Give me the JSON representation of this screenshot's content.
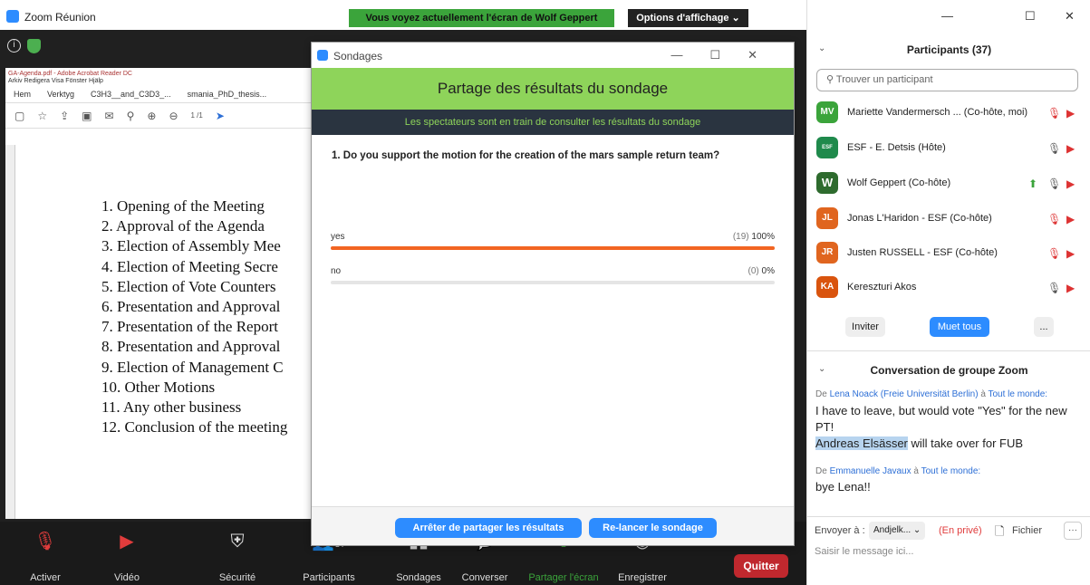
{
  "window": {
    "title": "Zoom Réunion"
  },
  "banner": {
    "text": "Vous voyez actuellement l'écran de Wolf Geppert",
    "options": "Options d'affichage ⌄"
  },
  "acrobat": {
    "title": "GA-Agenda.pdf - Adobe Acrobat Reader DC",
    "menu": "Arkiv  Redigera  Visa  Fönster  Hjälp",
    "tabs": [
      "Hem",
      "Verktyg",
      "C3H3__and_C3D3_...",
      "smania_PhD_thesis..."
    ],
    "page": "1 /1"
  },
  "agenda": [
    "1. Opening of the Meeting",
    "2. Approval of the Agenda",
    "3. Election of Assembly Mee",
    "4. Election of Meeting Secre",
    "5. Election of Vote Counters",
    "6. Presentation and Approval",
    "7. Presentation of the Report",
    "8. Presentation and Approval",
    "9. Election of Management C",
    "10. Other Motions",
    "11. Any other business",
    "12. Conclusion of the meeting"
  ],
  "toolbar": {
    "items": [
      {
        "label": "Activer",
        "icon": "mic-muted-icon"
      },
      {
        "label": "Vidéo",
        "icon": "video-off-icon"
      },
      {
        "label": "Sécurité",
        "icon": "shield-icon"
      },
      {
        "label": "Participants",
        "icon": "participants-icon",
        "count": "37"
      },
      {
        "label": "Sondages",
        "icon": "polls-icon"
      },
      {
        "label": "Converser",
        "icon": "chat-icon"
      },
      {
        "label": "Partager l'écran",
        "icon": "share-screen-icon"
      },
      {
        "label": "Enregistrer",
        "icon": "record-icon"
      }
    ],
    "quit": "Quitter"
  },
  "poll": {
    "window_title": "Sondages",
    "header": "Partage des résultats du sondage",
    "subheader": "Les spectateurs sont en train de consulter les résultats du sondage",
    "question": "1. Do you support the motion for the creation of the mars sample return team?",
    "answers": [
      {
        "label": "yes",
        "count": "(19)",
        "percent": "100%",
        "fraction": 1.0
      },
      {
        "label": "no",
        "count": "(0)",
        "percent": "0%",
        "fraction": 0
      }
    ],
    "stop_button": "Arrêter de partager les résultats",
    "relaunch_button": "Re-lancer le sondage",
    "accent": "#f26522"
  },
  "participants": {
    "title": "Participants (37)",
    "search_placeholder": "Trouver un participant",
    "list": [
      {
        "initials": "MV",
        "name": "Mariette Vandermersch ... (Co-hôte, moi)",
        "color": "#3ba43b"
      },
      {
        "initials": "",
        "name": "ESF - E. Detsis (Hôte)",
        "color": "#1f8a4c"
      },
      {
        "initials": "W",
        "name": "Wolf Geppert (Co-hôte)",
        "color": "#2e6b2e"
      },
      {
        "initials": "JL",
        "name": "Jonas L'Haridon - ESF (Co-hôte)",
        "color": "#e0651f"
      },
      {
        "initials": "JR",
        "name": "Justen RUSSELL - ESF (Co-hôte)",
        "color": "#e0651f"
      },
      {
        "initials": "KA",
        "name": "Kereszturi Akos",
        "color": "#d9540e"
      }
    ],
    "invite": "Inviter",
    "mute_all": "Muet tous",
    "more": "..."
  },
  "chat": {
    "title": "Conversation de groupe Zoom",
    "messages": [
      {
        "prefix": "De",
        "from": "Lena Noack (Freie Universität Berlin)",
        "to_word": "à",
        "to": "Tout le monde:",
        "text1": "I have to leave, but would vote \"Yes\" for the new PT!",
        "highlight": "Andreas Elsässer",
        "text2": " will take over for FUB"
      },
      {
        "prefix": "De",
        "from": "Emmanuelle Javaux",
        "to_word": "à",
        "to": "Tout le monde:",
        "text1": "bye Lena!!"
      }
    ],
    "send_to_label": "Envoyer à :",
    "recipient": "Andjelk... ⌄",
    "private": "(En privé)",
    "file": "Fichier",
    "input_placeholder": "Saisir le message ici...",
    "more": "···"
  }
}
